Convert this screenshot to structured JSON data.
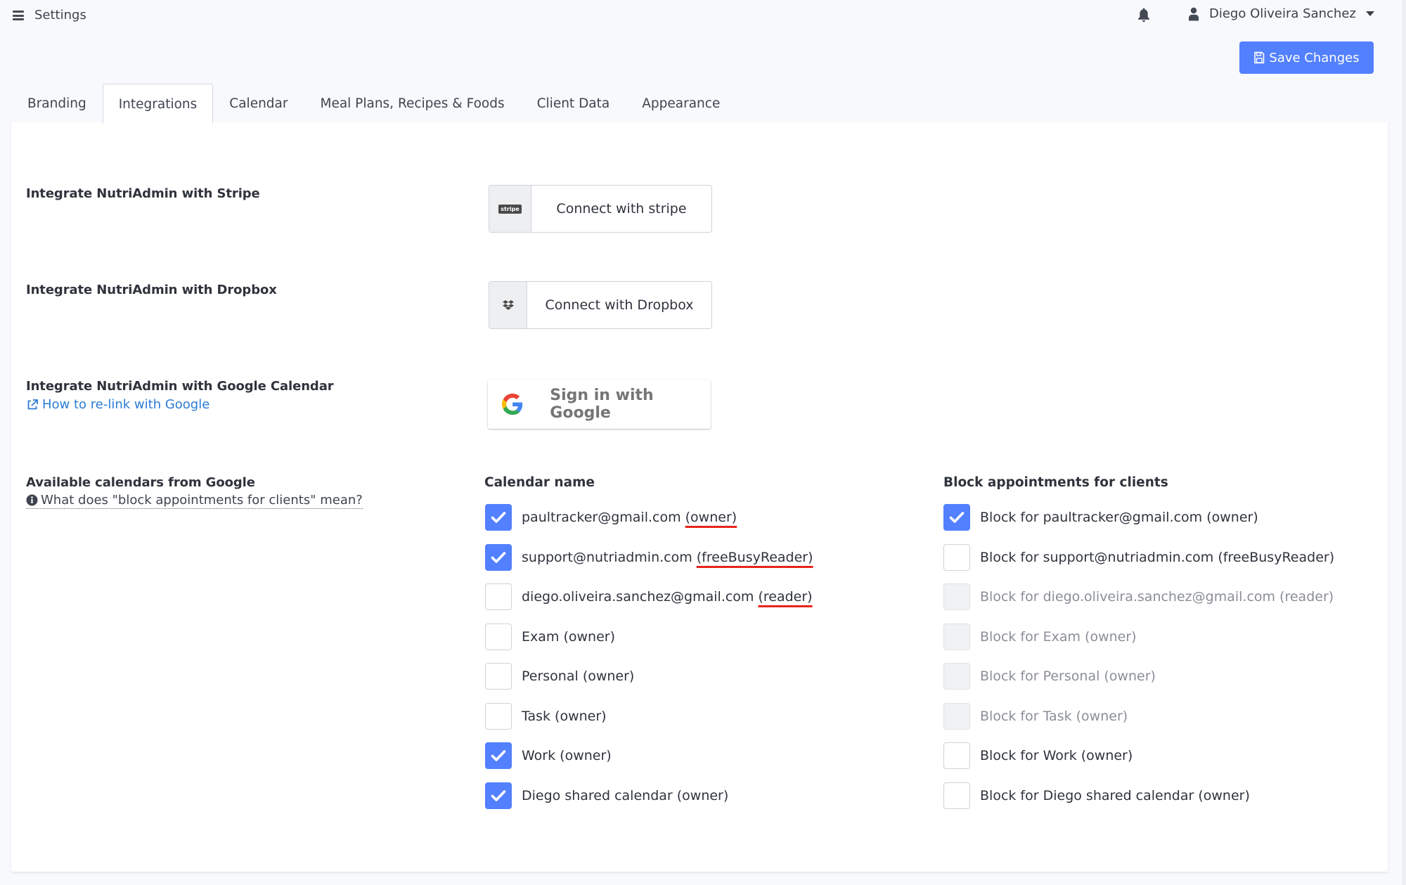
{
  "topbar": {
    "page_label": "Settings",
    "user_name": "Diego Oliveira Sanchez"
  },
  "toolbar": {
    "save_label": "Save Changes"
  },
  "tabs": [
    {
      "label": "Branding",
      "active": false
    },
    {
      "label": "Integrations",
      "active": true
    },
    {
      "label": "Calendar",
      "active": false
    },
    {
      "label": "Meal Plans, Recipes & Foods",
      "active": false
    },
    {
      "label": "Client Data",
      "active": false
    },
    {
      "label": "Appearance",
      "active": false
    }
  ],
  "integrations": {
    "stripe": {
      "label": "Integrate NutriAdmin with Stripe",
      "badge": "stripe",
      "button_label": "Connect with stripe"
    },
    "dropbox": {
      "label": "Integrate NutriAdmin with Dropbox",
      "button_label": "Connect with Dropbox"
    },
    "google": {
      "label": "Integrate NutriAdmin with Google Calendar",
      "relink_link": "How to re-link with Google",
      "button_label": "Sign in with Google"
    }
  },
  "calendars": {
    "section_label": "Available calendars from Google",
    "help_link": "What does \"block appointments for clients\" mean?",
    "col_name_header": "Calendar name",
    "col_block_header": "Block appointments for clients",
    "rows": [
      {
        "name": "paultracker@gmail.com",
        "role": "(owner)",
        "role_underlined": true,
        "enabled": true,
        "block_label": "Block for paultracker@gmail.com (owner)",
        "block_checked": true,
        "block_disabled": false
      },
      {
        "name": "support@nutriadmin.com",
        "role": "(freeBusyReader)",
        "role_underlined": true,
        "enabled": true,
        "block_label": "Block for support@nutriadmin.com (freeBusyReader)",
        "block_checked": false,
        "block_disabled": false
      },
      {
        "name": "diego.oliveira.sanchez@gmail.com",
        "role": "(reader)",
        "role_underlined": true,
        "enabled": false,
        "block_label": "Block for diego.oliveira.sanchez@gmail.com (reader)",
        "block_checked": false,
        "block_disabled": true
      },
      {
        "name": "Exam",
        "role": "(owner)",
        "role_underlined": false,
        "enabled": false,
        "block_label": "Block for Exam (owner)",
        "block_checked": false,
        "block_disabled": true
      },
      {
        "name": "Personal",
        "role": "(owner)",
        "role_underlined": false,
        "enabled": false,
        "block_label": "Block for Personal (owner)",
        "block_checked": false,
        "block_disabled": true
      },
      {
        "name": "Task",
        "role": "(owner)",
        "role_underlined": false,
        "enabled": false,
        "block_label": "Block for Task (owner)",
        "block_checked": false,
        "block_disabled": true
      },
      {
        "name": "Work",
        "role": "(owner)",
        "role_underlined": false,
        "enabled": true,
        "block_label": "Block for Work (owner)",
        "block_checked": false,
        "block_disabled": false
      },
      {
        "name": "Diego shared calendar",
        "role": "(owner)",
        "role_underlined": false,
        "enabled": true,
        "block_label": "Block for Diego shared calendar (owner)",
        "block_checked": false,
        "block_disabled": false
      }
    ]
  },
  "colors": {
    "accent": "#5280ff",
    "link": "#2b7bd4",
    "annotation_underline": "#e8231a"
  }
}
